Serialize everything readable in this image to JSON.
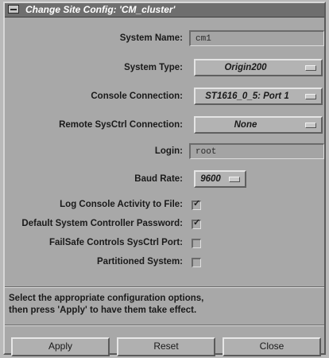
{
  "window": {
    "title": "Change Site Config: 'CM_cluster'"
  },
  "fields": {
    "system_name": {
      "label": "System Name:",
      "value": "cm1"
    },
    "system_type": {
      "label": "System Type:",
      "value": "Origin200"
    },
    "console_connection": {
      "label": "Console Connection:",
      "value": "ST1616_0_5: Port 1"
    },
    "remote_sysctrl": {
      "label": "Remote SysCtrl Connection:",
      "value": "None"
    },
    "login": {
      "label": "Login:",
      "value": "root"
    },
    "baud_rate": {
      "label": "Baud Rate:",
      "value": "9600"
    }
  },
  "checkboxes": {
    "log_console": {
      "label": "Log Console Activity to File:",
      "checked": true
    },
    "default_password": {
      "label": "Default System Controller Password:",
      "checked": true
    },
    "failsafe_controls": {
      "label": "FailSafe Controls SysCtrl Port:",
      "checked": false
    },
    "partitioned": {
      "label": "Partitioned System:",
      "checked": false
    }
  },
  "help": {
    "line1": "Select the appropriate configuration options,",
    "line2": "then press 'Apply' to have them take effect."
  },
  "buttons": {
    "apply": "Apply",
    "reset": "Reset",
    "close": "Close"
  },
  "icons": {
    "window_menu": "window-menu-icon",
    "option_indicator": "option-menu-indicator-icon",
    "check": "checkmark-icon"
  },
  "colors": {
    "background": "#a8a8a8",
    "titlebar": "#6e6e6e",
    "field": "#a4a4a4"
  }
}
